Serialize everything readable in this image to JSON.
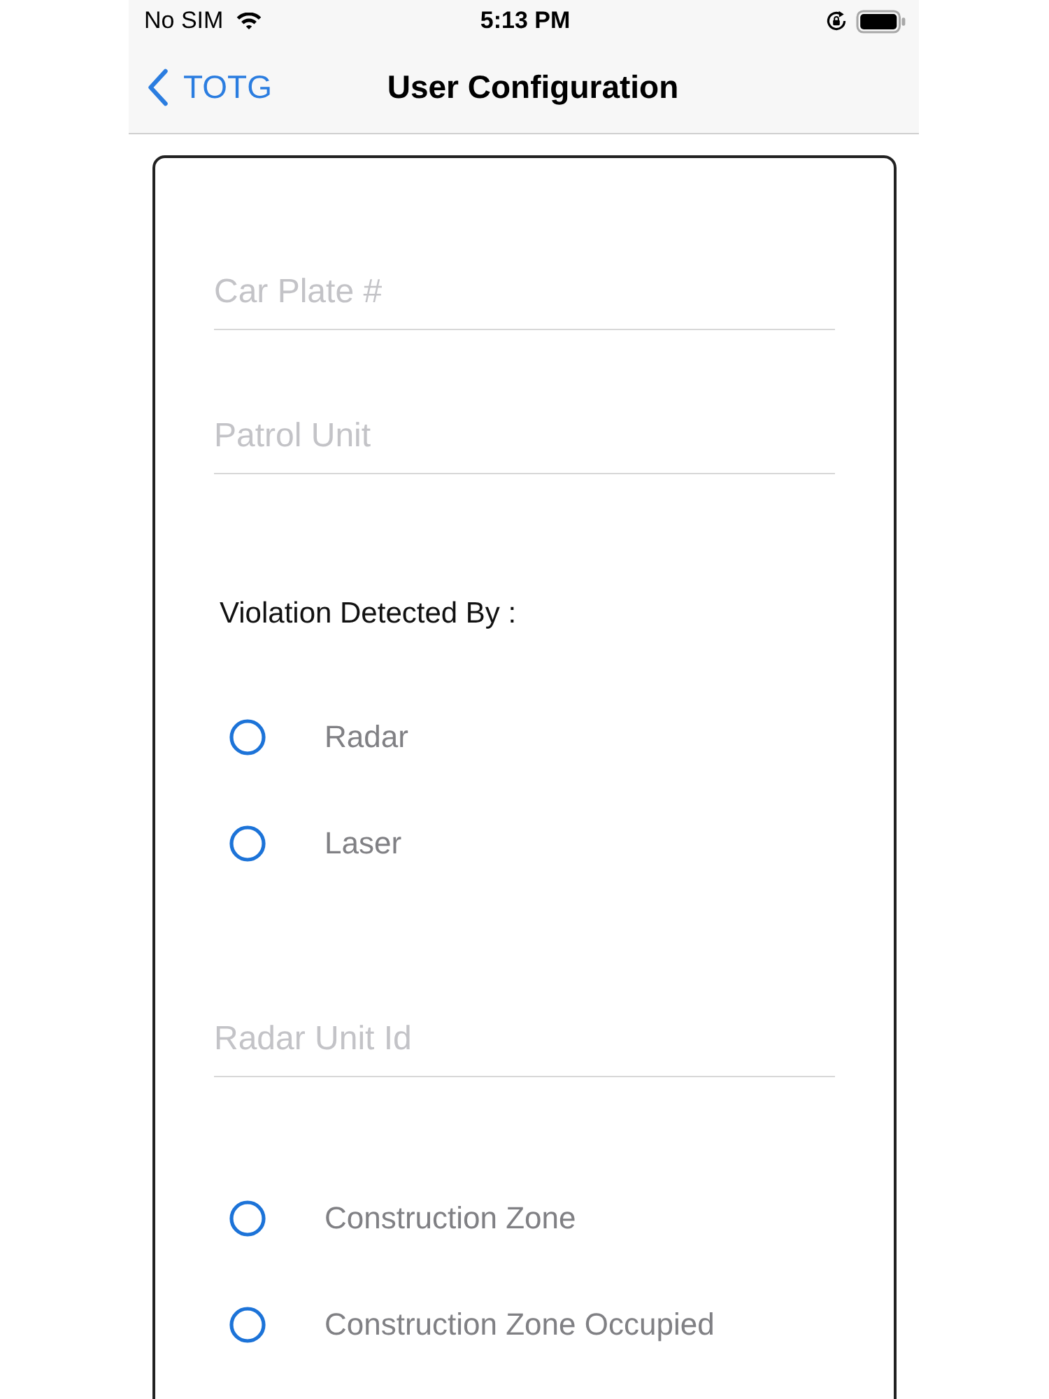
{
  "status_bar": {
    "carrier": "No SIM",
    "time": "5:13 PM"
  },
  "nav_bar": {
    "back_label": "TOTG",
    "title": "User Configuration"
  },
  "form": [
    {
      "kind": "field",
      "placeholder": "Car Plate #"
    },
    {
      "kind": "field",
      "placeholder": "Patrol Unit"
    },
    {
      "kind": "heading",
      "text": "Violation Detected By :"
    },
    {
      "kind": "radio",
      "label": "Radar",
      "selected": false
    },
    {
      "kind": "radio",
      "label": "Laser",
      "selected": false
    },
    {
      "kind": "field",
      "placeholder": "Radar Unit Id"
    },
    {
      "kind": "radio",
      "label": "Construction Zone",
      "selected": false
    },
    {
      "kind": "radio",
      "label": "Construction Zone Occupied",
      "selected": false
    }
  ]
}
